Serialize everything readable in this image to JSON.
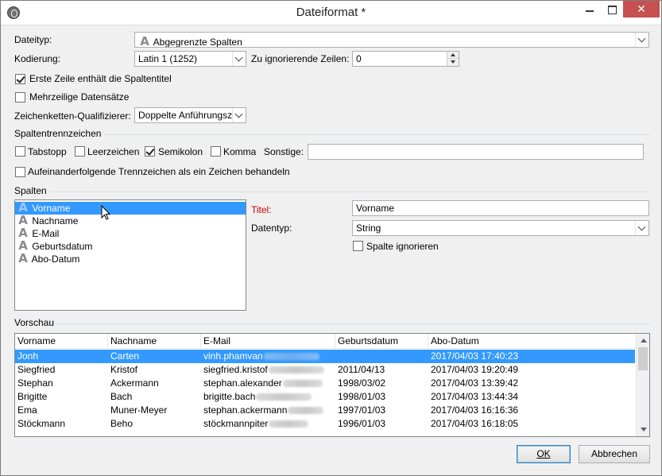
{
  "window": {
    "title": "Dateiformat *",
    "close_glyph": "✕"
  },
  "form": {
    "dateityp_label": "Dateityp:",
    "dateityp_value": "Abgegrenzte Spalten",
    "kodierung_label": "Kodierung:",
    "kodierung_value": "Latin 1 (1252)",
    "ignore_lines_label": "Zu ignorierende Zeilen:",
    "ignore_lines_value": "0",
    "first_row_header_label": "Erste Zeile enthält die Spaltentitel",
    "first_row_header_checked": true,
    "multiline_label": "Mehrzeilige Datensätze",
    "multiline_checked": false,
    "qualifier_label": "Zeichenketten-Qualifizierer:",
    "qualifier_value": "Doppelte Anführungsze"
  },
  "separators": {
    "section_title": "Spaltentrennzeichen",
    "tab_label": "Tabstopp",
    "tab_checked": false,
    "space_label": "Leerzeichen",
    "space_checked": false,
    "semicolon_label": "Semikolon",
    "semicolon_checked": true,
    "comma_label": "Komma",
    "comma_checked": false,
    "other_label": "Sonstige:",
    "other_value": "",
    "consecutive_label": "Aufeinanderfolgende Trennzeichen als ein Zeichen behandeln",
    "consecutive_checked": false
  },
  "columns": {
    "section_title": "Spalten",
    "items": [
      {
        "label": "Vorname",
        "icon": "text-column-icon",
        "selected": true
      },
      {
        "label": "Nachname",
        "icon": "text-column-icon",
        "selected": false
      },
      {
        "label": "E-Mail",
        "icon": "text-column-icon",
        "selected": false
      },
      {
        "label": "Geburtsdatum",
        "icon": "text-column-icon",
        "selected": false
      },
      {
        "label": "Abo-Datum",
        "icon": "text-column-icon",
        "selected": false
      }
    ],
    "titel_label": "Titel:",
    "titel_color": "#c00000",
    "titel_value": "Vorname",
    "datentyp_label": "Datentyp:",
    "datentyp_value": "String",
    "ignore_column_label": "Spalte ignorieren",
    "ignore_column_checked": false
  },
  "preview": {
    "section_title": "Vorschau",
    "headers": [
      "Vorname",
      "Nachname",
      "E-Mail",
      "Geburtsdatum",
      "Abo-Datum"
    ],
    "rows": [
      {
        "vorname": "Jonh",
        "nachname": "Carten",
        "email": "vinh.phamvan",
        "geburtsdatum": "",
        "abo": "2017/04/03 17:40:23",
        "selected": true
      },
      {
        "vorname": "Siegfried",
        "nachname": "Kristof",
        "email": "siegfried.kristof",
        "geburtsdatum": "2011/04/13",
        "abo": "2017/04/03 19:20:49",
        "selected": false
      },
      {
        "vorname": "Stephan",
        "nachname": "Ackermann",
        "email": "stephan.alexander",
        "geburtsdatum": "1998/03/02",
        "abo": "2017/04/03 13:39:42",
        "selected": false
      },
      {
        "vorname": "Brigitte",
        "nachname": "Bach",
        "email": "brigitte.bach",
        "geburtsdatum": "1998/01/03",
        "abo": "2017/04/03 13:44:34",
        "selected": false
      },
      {
        "vorname": "Ema",
        "nachname": "Muner-Meyer",
        "email": "stephan.ackermann",
        "geburtsdatum": "1997/01/03",
        "abo": "2017/04/03 16:16:36",
        "selected": false
      },
      {
        "vorname": "Stöckmann",
        "nachname": "Beho",
        "email": "stöckmannpiter",
        "geburtsdatum": "1996/01/03",
        "abo": "2017/04/03 16:18:05",
        "selected": false
      }
    ]
  },
  "buttons": {
    "ok_label": "OK",
    "cancel_label": "Abbrechen"
  }
}
